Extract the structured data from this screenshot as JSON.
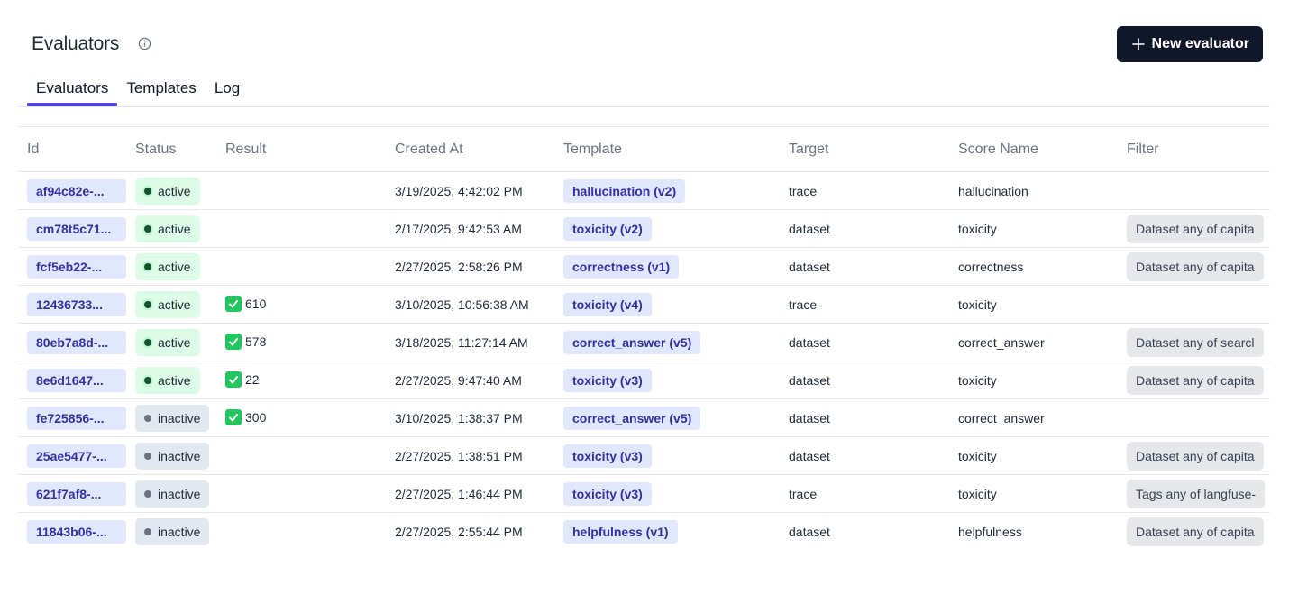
{
  "header": {
    "title": "Evaluators",
    "info_icon": "info-circle-icon",
    "new_button_label": "New evaluator",
    "new_button_icon": "plus-icon"
  },
  "tabs": [
    {
      "label": "Evaluators",
      "active": true
    },
    {
      "label": "Templates",
      "active": false
    },
    {
      "label": "Log",
      "active": false
    }
  ],
  "table": {
    "columns": [
      "Id",
      "Status",
      "Result",
      "Created At",
      "Template",
      "Target",
      "Score Name",
      "Filter"
    ],
    "rows": [
      {
        "id": "af94c82e-...",
        "status": "active",
        "result": "",
        "created_at": "3/19/2025, 4:42:02 PM",
        "template": "hallucination (v2)",
        "target": "trace",
        "score_name": "hallucination",
        "filter": ""
      },
      {
        "id": "cm78t5c71...",
        "status": "active",
        "result": "",
        "created_at": "2/17/2025, 9:42:53 AM",
        "template": "toxicity (v2)",
        "target": "dataset",
        "score_name": "toxicity",
        "filter": "Dataset any of capita"
      },
      {
        "id": "fcf5eb22-...",
        "status": "active",
        "result": "",
        "created_at": "2/27/2025, 2:58:26 PM",
        "template": "correctness (v1)",
        "target": "dataset",
        "score_name": "correctness",
        "filter": "Dataset any of capita"
      },
      {
        "id": "12436733...",
        "status": "active",
        "result": "610",
        "created_at": "3/10/2025, 10:56:38 AM",
        "template": "toxicity (v4)",
        "target": "trace",
        "score_name": "toxicity",
        "filter": ""
      },
      {
        "id": "80eb7a8d-...",
        "status": "active",
        "result": "578",
        "created_at": "3/18/2025, 11:27:14 AM",
        "template": "correct_answer (v5)",
        "target": "dataset",
        "score_name": "correct_answer",
        "filter": "Dataset any of searcl"
      },
      {
        "id": "8e6d1647...",
        "status": "active",
        "result": "22",
        "created_at": "2/27/2025, 9:47:40 AM",
        "template": "toxicity (v3)",
        "target": "dataset",
        "score_name": "toxicity",
        "filter": "Dataset any of capita"
      },
      {
        "id": "fe725856-...",
        "status": "inactive",
        "result": "300",
        "created_at": "3/10/2025, 1:38:37 PM",
        "template": "correct_answer (v5)",
        "target": "dataset",
        "score_name": "correct_answer",
        "filter": ""
      },
      {
        "id": "25ae5477-...",
        "status": "inactive",
        "result": "",
        "created_at": "2/27/2025, 1:38:51 PM",
        "template": "toxicity (v3)",
        "target": "dataset",
        "score_name": "toxicity",
        "filter": "Dataset any of capita"
      },
      {
        "id": "621f7af8-...",
        "status": "inactive",
        "result": "",
        "created_at": "2/27/2025, 1:46:44 PM",
        "template": "toxicity (v3)",
        "target": "trace",
        "score_name": "toxicity",
        "filter": "Tags any of langfuse-"
      },
      {
        "id": "11843b06-...",
        "status": "inactive",
        "result": "",
        "created_at": "2/27/2025, 2:55:44 PM",
        "template": "helpfulness (v1)",
        "target": "dataset",
        "score_name": "helpfulness",
        "filter": "Dataset any of capita"
      }
    ]
  },
  "colors": {
    "accent": "#4f46e5",
    "chip_bg": "#e0e7ff",
    "chip_text": "#3730a3",
    "active_bg": "#dcfce7",
    "inactive_bg": "#e2e8f0",
    "check_green": "#22c55e",
    "button_bg": "#0f172a"
  }
}
